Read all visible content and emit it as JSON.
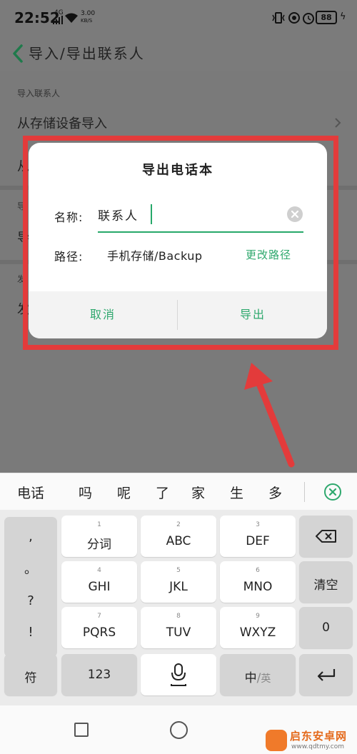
{
  "status_bar": {
    "time": "22:52",
    "network_type": "4G",
    "net_speed_value": "3.00",
    "net_speed_unit": "KB/S",
    "battery": "88"
  },
  "header": {
    "title": "导入/导出联系人"
  },
  "background_list": {
    "section_import": "导入联系人",
    "row_import_storage": "从存储设备导入",
    "row_partial_1": "从",
    "section_partial_2": "导",
    "row_partial_2": "导",
    "section_partial_3": "发",
    "row_partial_3": "发"
  },
  "dialog": {
    "title": "导出电话本",
    "name_label": "名称:",
    "name_value": "联系人",
    "path_label": "路径:",
    "path_value": "手机存储/Backup",
    "change_path": "更改路径",
    "cancel": "取消",
    "export": "导出"
  },
  "candidates": [
    "电话",
    "吗",
    "呢",
    "了",
    "家",
    "生",
    "多"
  ],
  "keyboard": {
    "punctuation": [
      ",",
      "。",
      "?",
      "!"
    ],
    "keys": [
      {
        "num": "1",
        "label": "分词"
      },
      {
        "num": "2",
        "label": "ABC"
      },
      {
        "num": "3",
        "label": "DEF"
      },
      {
        "num": "4",
        "label": "GHI"
      },
      {
        "num": "5",
        "label": "JKL"
      },
      {
        "num": "6",
        "label": "MNO"
      },
      {
        "num": "7",
        "label": "PQRS"
      },
      {
        "num": "8",
        "label": "TUV"
      },
      {
        "num": "9",
        "label": "WXYZ"
      }
    ],
    "clear": "清空",
    "zero": "0",
    "symbols": "符",
    "numbers": "123",
    "lang_zh": "中",
    "lang_sep": "/",
    "lang_en": "英"
  },
  "watermark": {
    "text": "启东安卓网",
    "url": "www.qdtmy.com"
  },
  "colors": {
    "accent_green": "#2ea86d",
    "annotation_red": "#e33b3b",
    "dim_background": "#7a7a7a"
  }
}
